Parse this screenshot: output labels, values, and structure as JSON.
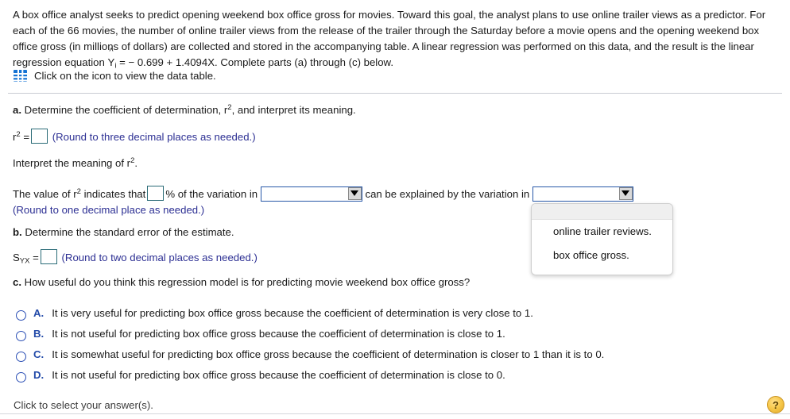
{
  "problem": {
    "paragraph_part1": "A box office analyst seeks to predict opening weekend box office gross for movies. Toward this goal, the analyst plans to use online trailer views as a predictor. For each of the 66 movies, the number of online trailer views from the release of the trailer through the Saturday before a movie opens and the opening weekend box office gross (in millions of dollars) are collected and stored in the accompanying table. A linear regression was performed on this data, and the result is the linear regression equation",
    "equation_y": "Y",
    "equation_sub": "i",
    "equation_rest": " = − 0.699 + 1.4094X. Complete parts (a) through (c) below.",
    "table_link_label": "Click on the icon to view the data table.",
    "table_icon": "grid-table-icon"
  },
  "part_a": {
    "label": "a.",
    "prompt_before": "Determine the coefficient of determination, r",
    "prompt_exponent": "2",
    "prompt_after": ", and interpret its meaning.",
    "r_label": "r",
    "r_exponent": "2",
    "equals": "=",
    "round_hint": "(Round to three decimal places as needed.)",
    "interpret_line_before": "Interpret the meaning of r",
    "interpret_line_after": ".",
    "value_line_before": "The value of r",
    "value_line_mid": " indicates that",
    "value_line_percent": "% of the variation in",
    "value_line_explained": "can be explained by the variation in",
    "round_hint2": "(Round to one decimal place as needed.)"
  },
  "dropdown1": {
    "name": "variation-in-dropdown",
    "value": "",
    "arrow": "chevron-down-icon"
  },
  "dropdown2": {
    "name": "explained-by-dropdown",
    "value": "",
    "arrow": "chevron-down-icon",
    "open": true,
    "options": [
      "",
      "online trailer reviews.",
      "box office gross."
    ]
  },
  "part_b": {
    "label": "b.",
    "prompt": "Determine the standard error of the estimate.",
    "symbol_main": "S",
    "symbol_sub": "YX",
    "equals": "=",
    "round_hint": "(Round to two decimal places as needed.)"
  },
  "part_c": {
    "label": "c.",
    "prompt": "How useful do you think this regression model is for predicting movie weekend box office gross?",
    "choices": [
      {
        "letter": "A.",
        "text": "It is very useful for predicting box office gross because the coefficient of determination is very close to 1."
      },
      {
        "letter": "B.",
        "text": "It is not useful for predicting box office gross because the coefficient of determination is close to 1."
      },
      {
        "letter": "C.",
        "text": "It is somewhat useful for predicting box office gross because the coefficient of determination is closer to 1 than it is to 0."
      },
      {
        "letter": "D.",
        "text": "It is not useful for predicting box office gross because the coefficient of determination is close to 0."
      }
    ]
  },
  "footer": {
    "status": "Click to select your answer(s).",
    "help_label": "?"
  },
  "colors": {
    "link_blue": "#1674d4",
    "hint_blue": "#2c2f93",
    "choice_blue": "#2149a8",
    "select_border": "#2858a8",
    "input_border": "#2a6b77",
    "help_gold": "#f7c84a"
  }
}
